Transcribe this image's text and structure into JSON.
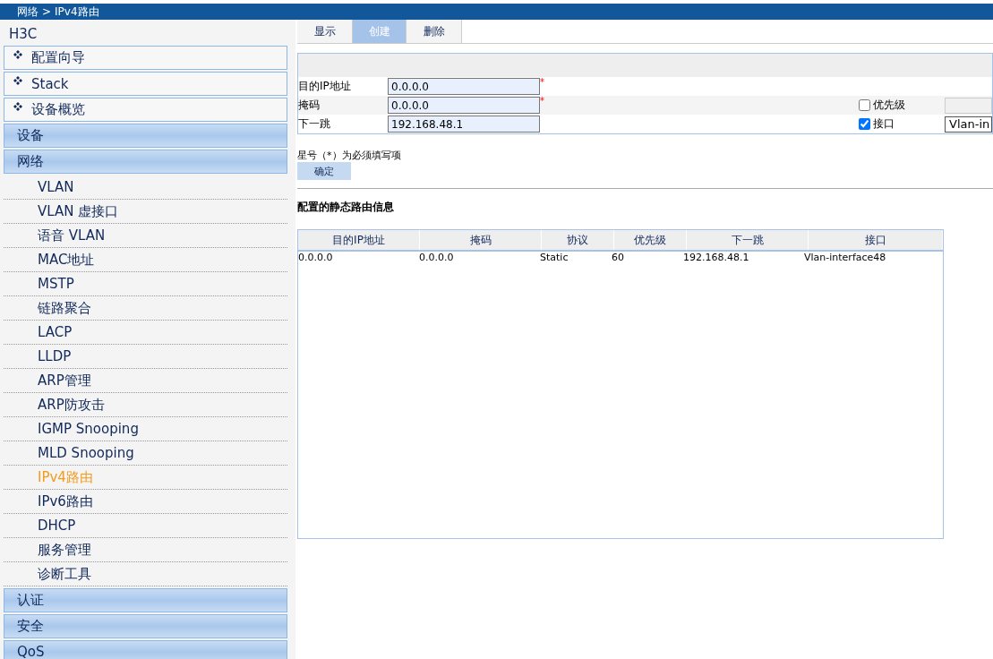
{
  "breadcrumb": {
    "items": [
      "网络",
      ">",
      "IPv4路由"
    ]
  },
  "sidebar": {
    "brand": "H3C",
    "quick_links": [
      "配置向导",
      "Stack",
      "设备概览"
    ],
    "groups": [
      {
        "label": "设备"
      },
      {
        "label": "网络",
        "items": [
          {
            "label": "VLAN",
            "selected": false
          },
          {
            "label": "VLAN 虚接口",
            "selected": false
          },
          {
            "label": "语音 VLAN",
            "selected": false
          },
          {
            "label": "MAC地址",
            "selected": false
          },
          {
            "label": "MSTP",
            "selected": false
          },
          {
            "label": "链路聚合",
            "selected": false
          },
          {
            "label": "LACP",
            "selected": false
          },
          {
            "label": "LLDP",
            "selected": false
          },
          {
            "label": "ARP管理",
            "selected": false
          },
          {
            "label": "ARP防攻击",
            "selected": false
          },
          {
            "label": "IGMP Snooping",
            "selected": false
          },
          {
            "label": "MLD Snooping",
            "selected": false
          },
          {
            "label": "IPv4路由",
            "selected": true
          },
          {
            "label": "IPv6路由",
            "selected": false
          },
          {
            "label": "DHCP",
            "selected": false
          },
          {
            "label": "服务管理",
            "selected": false
          },
          {
            "label": "诊断工具",
            "selected": false
          }
        ]
      },
      {
        "label": "认证"
      },
      {
        "label": "安全"
      },
      {
        "label": "QoS"
      }
    ]
  },
  "tabs": [
    {
      "label": "显示",
      "selected": false
    },
    {
      "label": "创建",
      "selected": true
    },
    {
      "label": "删除",
      "selected": false
    }
  ],
  "form": {
    "fields": [
      {
        "label": "目的IP地址",
        "value": "0.0.0.0",
        "required": true
      },
      {
        "label": "掩码",
        "value": "0.0.0.0",
        "required": true
      },
      {
        "label": "下一跳",
        "value": "192.168.48.1",
        "required": false
      }
    ],
    "required_mark": "*",
    "options": [
      {
        "label": "优先级",
        "checked": false
      },
      {
        "label": "接口",
        "checked": true,
        "value": "Vlan-in"
      }
    ],
    "note": "星号（*）为必须填写项",
    "submit": "确定"
  },
  "table": {
    "title": "配置的静态路由信息",
    "columns": [
      "目的IP地址",
      "掩码",
      "协议",
      "优先级",
      "下一跳",
      "接口"
    ],
    "rows": [
      [
        "0.0.0.0",
        "0.0.0.0",
        "Static",
        "60",
        "192.168.48.1",
        "Vlan-interface48"
      ]
    ]
  }
}
